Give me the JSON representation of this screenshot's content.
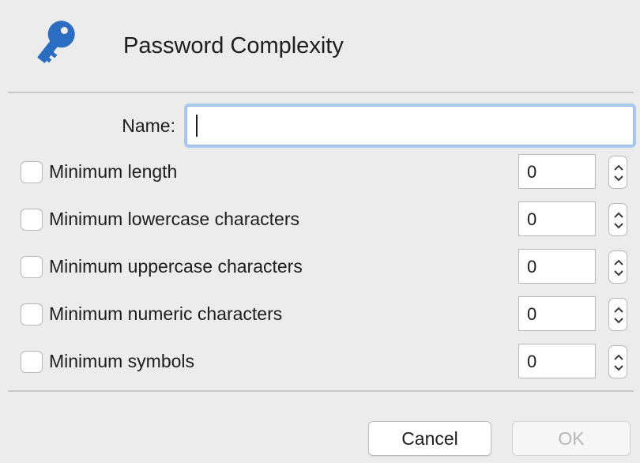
{
  "dialog": {
    "title": "Password Complexity",
    "icon": "key-icon",
    "accent_color": "#2b6dc1"
  },
  "name_field": {
    "label": "Name:",
    "value": "",
    "focused": true
  },
  "rules": [
    {
      "label": "Minimum length",
      "checked": false,
      "value": "0"
    },
    {
      "label": "Minimum lowercase characters",
      "checked": false,
      "value": "0"
    },
    {
      "label": "Minimum uppercase characters",
      "checked": false,
      "value": "0"
    },
    {
      "label": "Minimum numeric characters",
      "checked": false,
      "value": "0"
    },
    {
      "label": "Minimum symbols",
      "checked": false,
      "value": "0"
    }
  ],
  "buttons": {
    "cancel_label": "Cancel",
    "ok_label": "OK",
    "ok_enabled": false
  }
}
